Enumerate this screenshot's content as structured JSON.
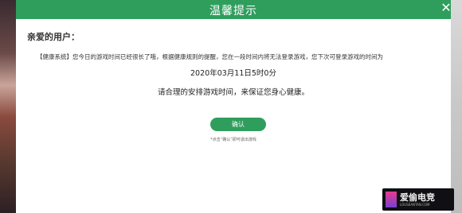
{
  "dialog": {
    "title": "温馨提示",
    "close_label": "✕",
    "greeting": "亲爱的用户：",
    "notice": "【健康系统】您今日的游戏时间已经很长了哦，根据健康规则的提醒，您在一段时间内将无法登录游戏，您下次可登录游戏的时间为",
    "next_login_time": "2020年03月11日5时0分",
    "advice": "请合理的安排游戏时间，来保证您身心健康。",
    "confirm_label": "确认",
    "hint": "*点击“确认”即可退出游戏"
  },
  "watermark": {
    "text": "爱偷电竞",
    "sub": "LOUSEANTAN.COM"
  },
  "colors": {
    "accent": "#2f9e5d",
    "text": "#333333"
  }
}
